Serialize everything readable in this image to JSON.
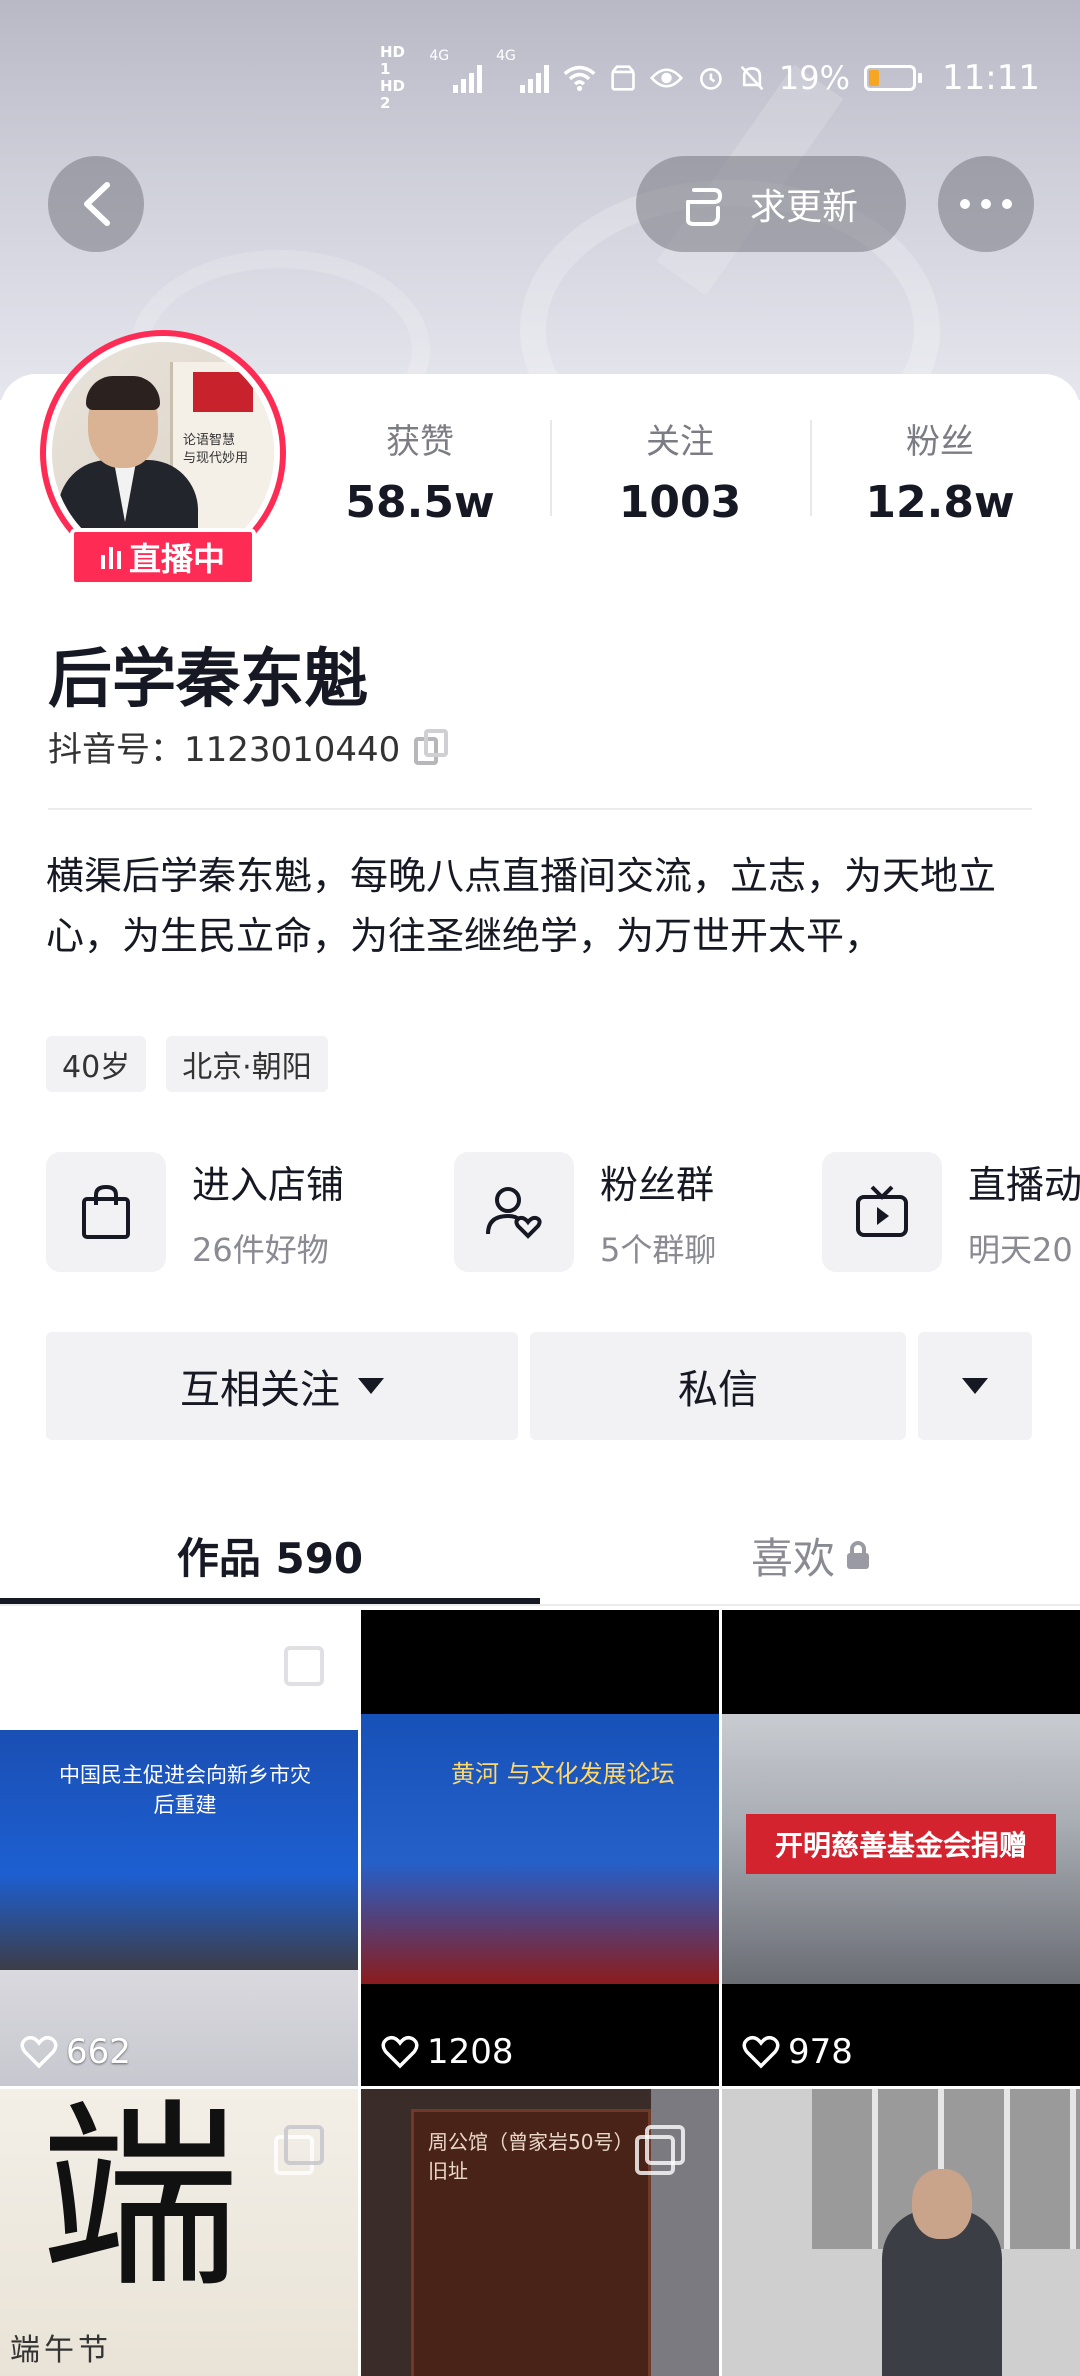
{
  "status_bar": {
    "hd1": "HD 1",
    "hd2": "HD 2",
    "net1": "4G",
    "net2": "4G",
    "battery": "19%",
    "time": "11:11",
    "battery_color": "#f5a623"
  },
  "top_bar": {
    "update_label": "求更新"
  },
  "profile": {
    "live_badge": "直播中",
    "name": "后学秦东魁",
    "douyin_id": "抖音号：1123010440",
    "bio": "横渠后学秦东魁，每晚八点直播间交流，立志，为天地立心，为生民立命，为往圣继绝学，为万世开太平，",
    "tags": [
      "40岁",
      "北京·朝阳"
    ]
  },
  "stats": [
    {
      "label": "获赞",
      "value": "58.5w"
    },
    {
      "label": "关注",
      "value": "1003"
    },
    {
      "label": "粉丝",
      "value": "12.8w"
    }
  ],
  "shortcuts": [
    {
      "title": "进入店铺",
      "sub": "26件好物",
      "icon": "shopping-bag-icon"
    },
    {
      "title": "粉丝群",
      "sub": "5个群聊",
      "icon": "fan-group-icon"
    },
    {
      "title": "直播动",
      "sub": "明天20",
      "icon": "live-tv-icon"
    }
  ],
  "actions": {
    "follow_label": "互相关注",
    "message_label": "私信"
  },
  "tabs": [
    {
      "label": "作品 590",
      "active": true
    },
    {
      "label": "喜欢",
      "active": false
    }
  ],
  "videos": [
    {
      "likes": "662",
      "banner": "中国民主促进会向新乡市灾后重建"
    },
    {
      "likes": "1208",
      "banner": "黄河 与文化发展论坛"
    },
    {
      "likes": "978",
      "banner": "开明慈善基金会捐赠"
    },
    {
      "likes": "",
      "banner": "端午节"
    },
    {
      "likes": "",
      "banner": "周公馆（曾家岩50号）旧址"
    },
    {
      "likes": "",
      "banner": ""
    }
  ],
  "colors": {
    "accent": "#fe2c55",
    "text": "#161823",
    "secondary": "#8a8a92"
  }
}
